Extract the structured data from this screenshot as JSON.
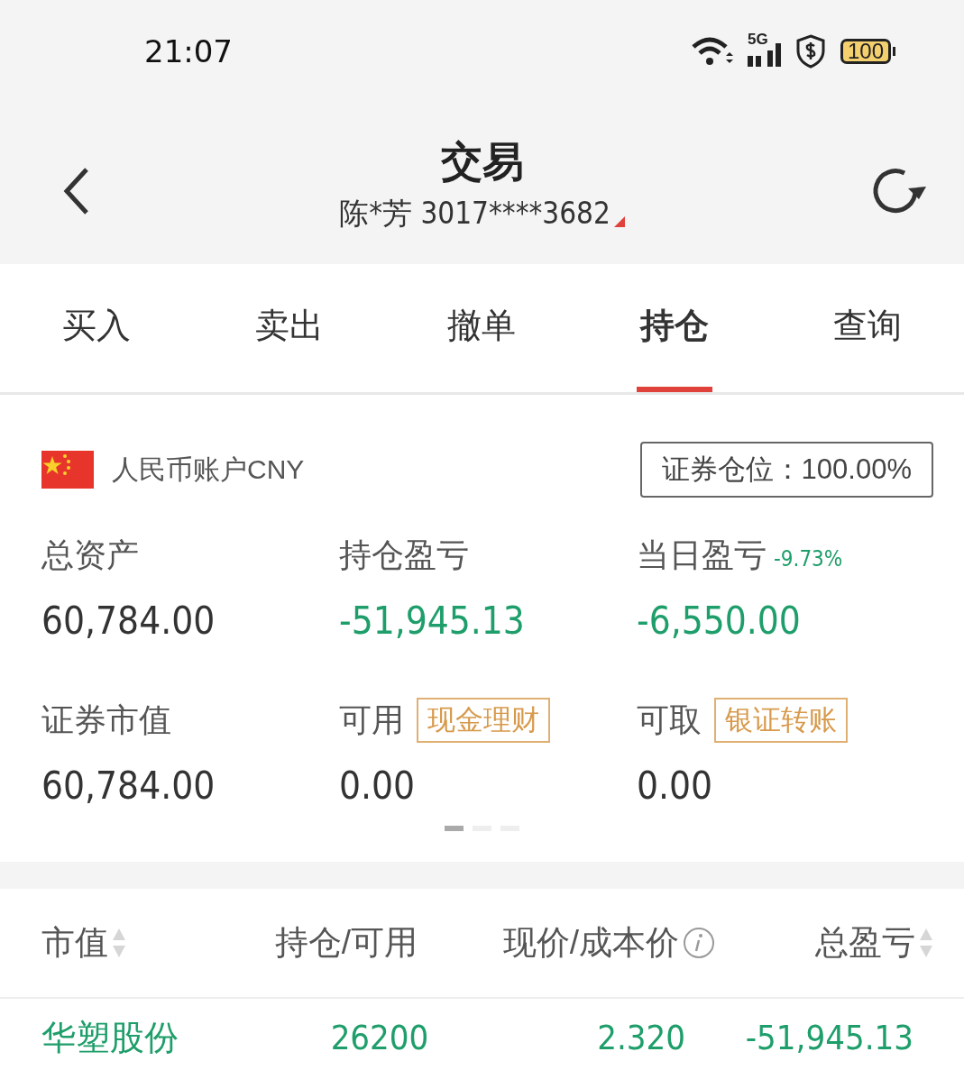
{
  "status_bar": {
    "time": "21:07",
    "network": "5G",
    "battery": "100"
  },
  "header": {
    "title": "交易",
    "account": "陈*芳 3017****3682"
  },
  "tabs": [
    {
      "label": "买入",
      "selected": false
    },
    {
      "label": "卖出",
      "selected": false
    },
    {
      "label": "撤单",
      "selected": false
    },
    {
      "label": "持仓",
      "selected": true
    },
    {
      "label": "查询",
      "selected": false
    }
  ],
  "account_card": {
    "currency_account": "人民币账户CNY",
    "position_ratio": "证券仓位：100.00%",
    "metrics": [
      {
        "label": "总资产",
        "value": "60,784.00",
        "kind": "plain"
      },
      {
        "label": "持仓盈亏",
        "value": "-51,945.13",
        "kind": "loss"
      },
      {
        "label": "当日盈亏",
        "value": "-6,550.00",
        "kind": "loss",
        "change": "-9.73%"
      },
      {
        "label": "证券市值",
        "value": "60,784.00",
        "kind": "plain"
      },
      {
        "label": "可用",
        "value": "0.00",
        "kind": "plain",
        "action": "现金理财"
      },
      {
        "label": "可取",
        "value": "0.00",
        "kind": "plain",
        "action": "银证转账"
      }
    ],
    "pages": [
      {
        "selected": true
      },
      {
        "selected": false
      },
      {
        "selected": false
      }
    ]
  },
  "holdings": {
    "columns": [
      {
        "label": "市值",
        "sortable": true,
        "info": false
      },
      {
        "label": "持仓/可用",
        "sortable": false,
        "info": false
      },
      {
        "label": "现价/成本价",
        "sortable": false,
        "info": true
      },
      {
        "label": "总盈亏",
        "sortable": true,
        "info": false
      }
    ],
    "rows": [
      {
        "cells": [
          "华塑股份",
          "26200",
          "2.320",
          "-51,945.13"
        ],
        "kind": "loss"
      }
    ]
  }
}
